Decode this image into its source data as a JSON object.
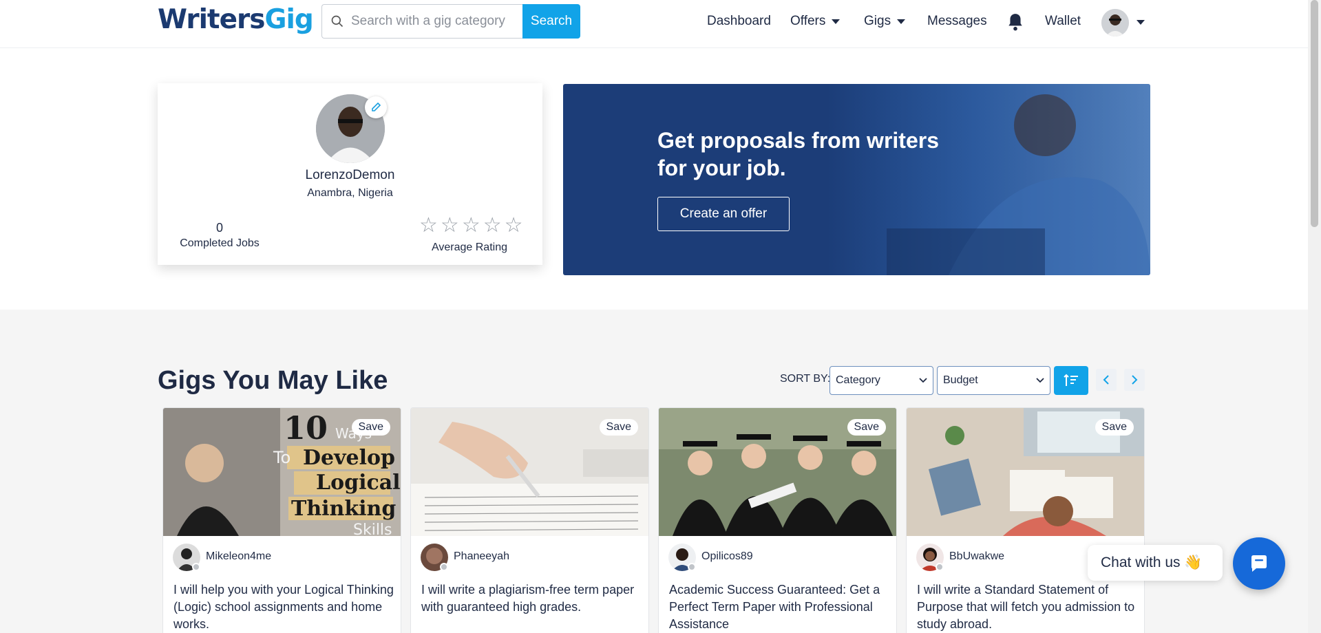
{
  "navbar": {
    "logo_part1": "Writers",
    "logo_part2": "Gig",
    "search_placeholder": "Search with a gig category",
    "search_button": "Search",
    "dashboard": "Dashboard",
    "offers": "Offers",
    "gigs": "Gigs",
    "messages": "Messages",
    "wallet": "Wallet"
  },
  "profile": {
    "username": "LorenzoDemon",
    "location": "Anambra, Nigeria",
    "completed_jobs_count": "0",
    "completed_jobs_label": "Completed Jobs",
    "average_rating_label": "Average Rating",
    "rating_value": 0,
    "rating_max": 5
  },
  "hero": {
    "heading": "Get proposals from writers for your job.",
    "button": "Create an offer"
  },
  "gigs": {
    "title": "Gigs You May Like",
    "sort_label": "SORT BY:",
    "sort_category": "Category",
    "sort_budget": "Budget",
    "cards": [
      {
        "save": "Save",
        "author": "Mikeleon4me",
        "title": "I will help you with your Logical Thinking (Logic) school assignments and home works."
      },
      {
        "save": "Save",
        "author": "Phaneeyah",
        "title": "I will write a plagiarism-free term paper with guaranteed high grades."
      },
      {
        "save": "Save",
        "author": "Opilicos89",
        "title": "Academic Success Guaranteed: Get a Perfect Term Paper with Professional Assistance"
      },
      {
        "save": "Save",
        "author": "BbUwakwe",
        "title": "I will write a Standard Statement of Purpose that will fetch you admission to study abroad."
      }
    ],
    "card1_image_text": {
      "line1": "10",
      "line2": "Ways",
      "line3": "To",
      "line4": "Develop",
      "line5": "Logical",
      "line6": "Thinking",
      "line7": "Skills"
    }
  },
  "chat": {
    "label": "Chat with us 👋"
  },
  "colors": {
    "brand_dark": "#1b3a70",
    "brand_light": "#1aa0e0",
    "accent": "#11a3e8",
    "hero_bg": "#1c3d78"
  }
}
